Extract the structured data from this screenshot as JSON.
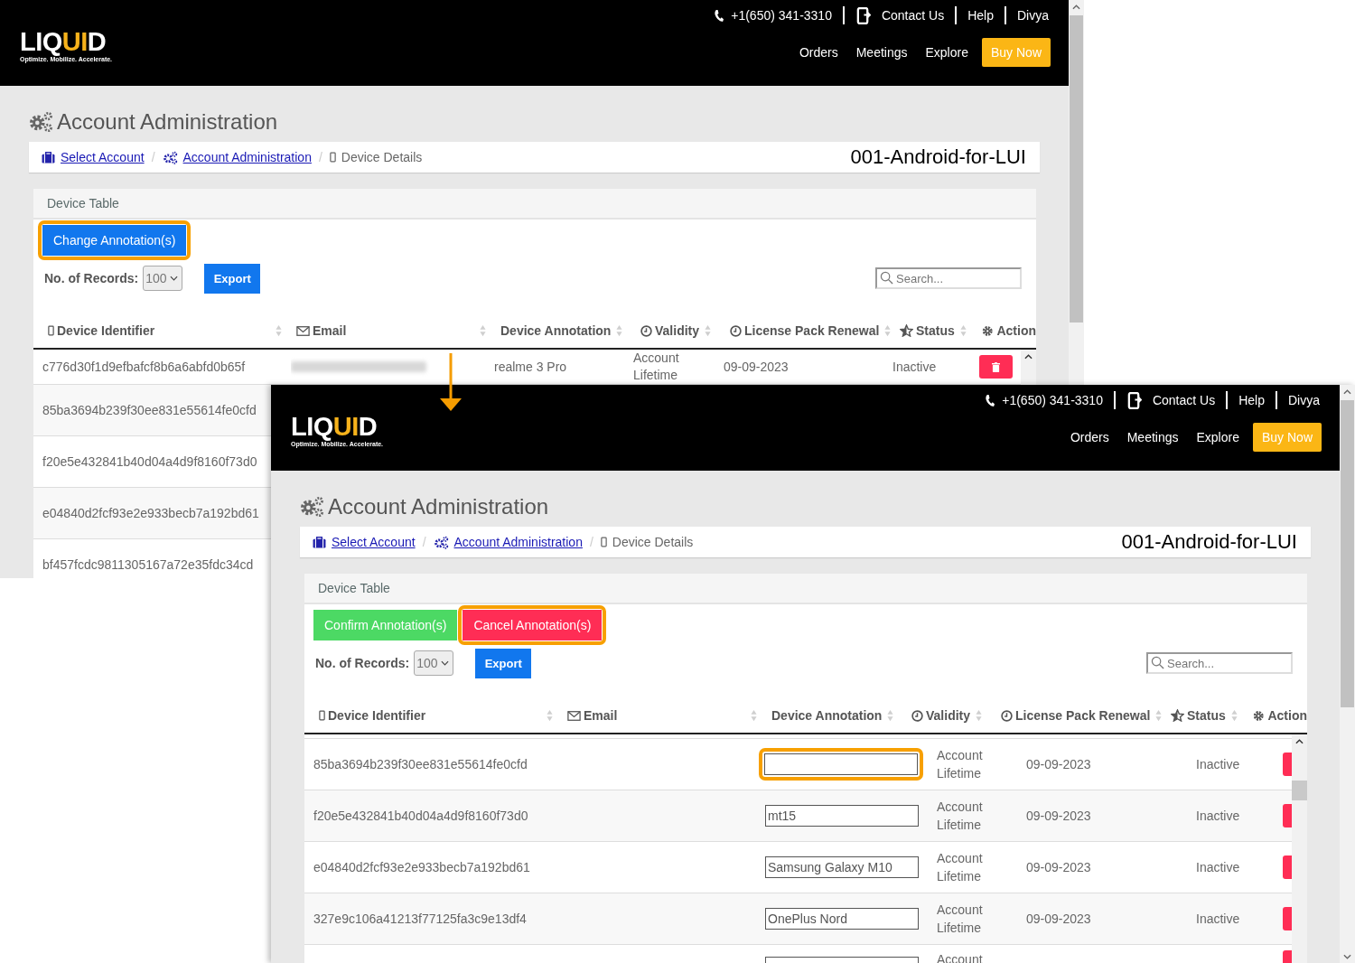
{
  "screens": [
    {
      "header": {
        "logo": [
          {
            "text": "LIQ",
            "accent": false
          },
          {
            "text": "UI",
            "accent": true
          },
          {
            "text": "D",
            "accent": false
          }
        ],
        "tagline": "Optimize. Mobilize. Accelerate.",
        "phone": "+1(650) 341-3310",
        "links": [
          "Contact Us",
          "Help",
          "Divya"
        ],
        "nav": [
          "Orders",
          "Meetings",
          "Explore"
        ],
        "cta": "Buy Now"
      },
      "page_title": "Account Administration",
      "breadcrumb": [
        {
          "label": "Select Account",
          "kind": "link"
        },
        {
          "separator": "/",
          "label": "Account Administration",
          "kind": "link"
        },
        {
          "separator": "/",
          "label": "Device Details",
          "kind": "current"
        }
      ],
      "account_name": "001-Android-for-LUI",
      "card_title": "Device Table",
      "actions": [
        {
          "label": "Change Annotation(s)",
          "kind": "primary",
          "highlighted": true
        }
      ],
      "records_label": "No. of Records:",
      "records_value": "100",
      "export_label": "Export",
      "search_placeholder": "Search...",
      "columns": [
        "Device Identifier",
        "Email",
        "Device Annotation",
        "Validity",
        "License Pack Renewal",
        "Status",
        "Action"
      ],
      "rows": [
        {
          "kind": "full",
          "identifier": "c776d30f1d9efbafcf8b6a6abfd0b65f",
          "annotation": "realme 3 Pro",
          "validity": "Account Lifetime",
          "renewal": "09-09-2023",
          "status": "Inactive"
        },
        {
          "kind": "id-only",
          "identifier": "85ba3694b239f30ee831e55614fe0cfd"
        },
        {
          "kind": "id-only",
          "identifier": "f20e5e432841b40d04a4d9f8160f73d0"
        },
        {
          "kind": "id-only",
          "identifier": "e04840d2fcf93e2e933becb7a192bd61"
        },
        {
          "kind": "id-only",
          "identifier": "bf457fcdc9811305167a72e35fdc34cd"
        }
      ]
    },
    {
      "header": {
        "logo": [
          {
            "text": "LIQ",
            "accent": false
          },
          {
            "text": "UI",
            "accent": true
          },
          {
            "text": "D",
            "accent": false
          }
        ],
        "tagline": "Optimize. Mobilize. Accelerate.",
        "phone": "+1(650) 341-3310",
        "links": [
          "Contact Us",
          "Help",
          "Divya"
        ],
        "nav": [
          "Orders",
          "Meetings",
          "Explore"
        ],
        "cta": "Buy Now"
      },
      "page_title": "Account Administration",
      "breadcrumb": [
        {
          "label": "Select Account",
          "kind": "link"
        },
        {
          "separator": "/",
          "label": "Account Administration",
          "kind": "link"
        },
        {
          "separator": "/",
          "label": "Device Details",
          "kind": "current"
        }
      ],
      "account_name": "001-Android-for-LUI",
      "card_title": "Device Table",
      "actions": [
        {
          "label": "Confirm Annotation(s)",
          "kind": "success",
          "highlighted": false
        },
        {
          "label": "Cancel Annotation(s)",
          "kind": "danger",
          "highlighted": true
        }
      ],
      "records_label": "No. of Records:",
      "records_value": "100",
      "export_label": "Export",
      "search_placeholder": "Search...",
      "columns": [
        "Device Identifier",
        "Email",
        "Device Annotation",
        "Validity",
        "License Pack Renewal",
        "Status",
        "Action"
      ],
      "rows": [
        {
          "kind": "edit",
          "identifier": "85ba3694b239f30ee831e55614fe0cfd",
          "highlighted": true,
          "validity": "Account Lifetime",
          "renewal": "09-09-2023",
          "status": "Inactive"
        },
        {
          "kind": "edit",
          "identifier": "f20e5e432841b40d04a4d9f8160f73d0",
          "annotation": "mt15",
          "highlighted": false,
          "validity": "Account Lifetime",
          "renewal": "09-09-2023",
          "status": "Inactive"
        },
        {
          "kind": "edit",
          "identifier": "e04840d2fcf93e2e933becb7a192bd61",
          "annotation": "Samsung Galaxy M10",
          "highlighted": false,
          "validity": "Account Lifetime",
          "renewal": "09-09-2023",
          "status": "Inactive"
        },
        {
          "kind": "edit",
          "identifier": "327e9c106a41213f77125fa3c9e13df4",
          "annotation": "OnePlus Nord",
          "highlighted": false,
          "validity": "Account Lifetime",
          "renewal": "09-09-2023",
          "status": "Inactive"
        },
        {
          "kind": "edit-partial",
          "highlighted": false,
          "validity": "Account"
        }
      ]
    }
  ]
}
